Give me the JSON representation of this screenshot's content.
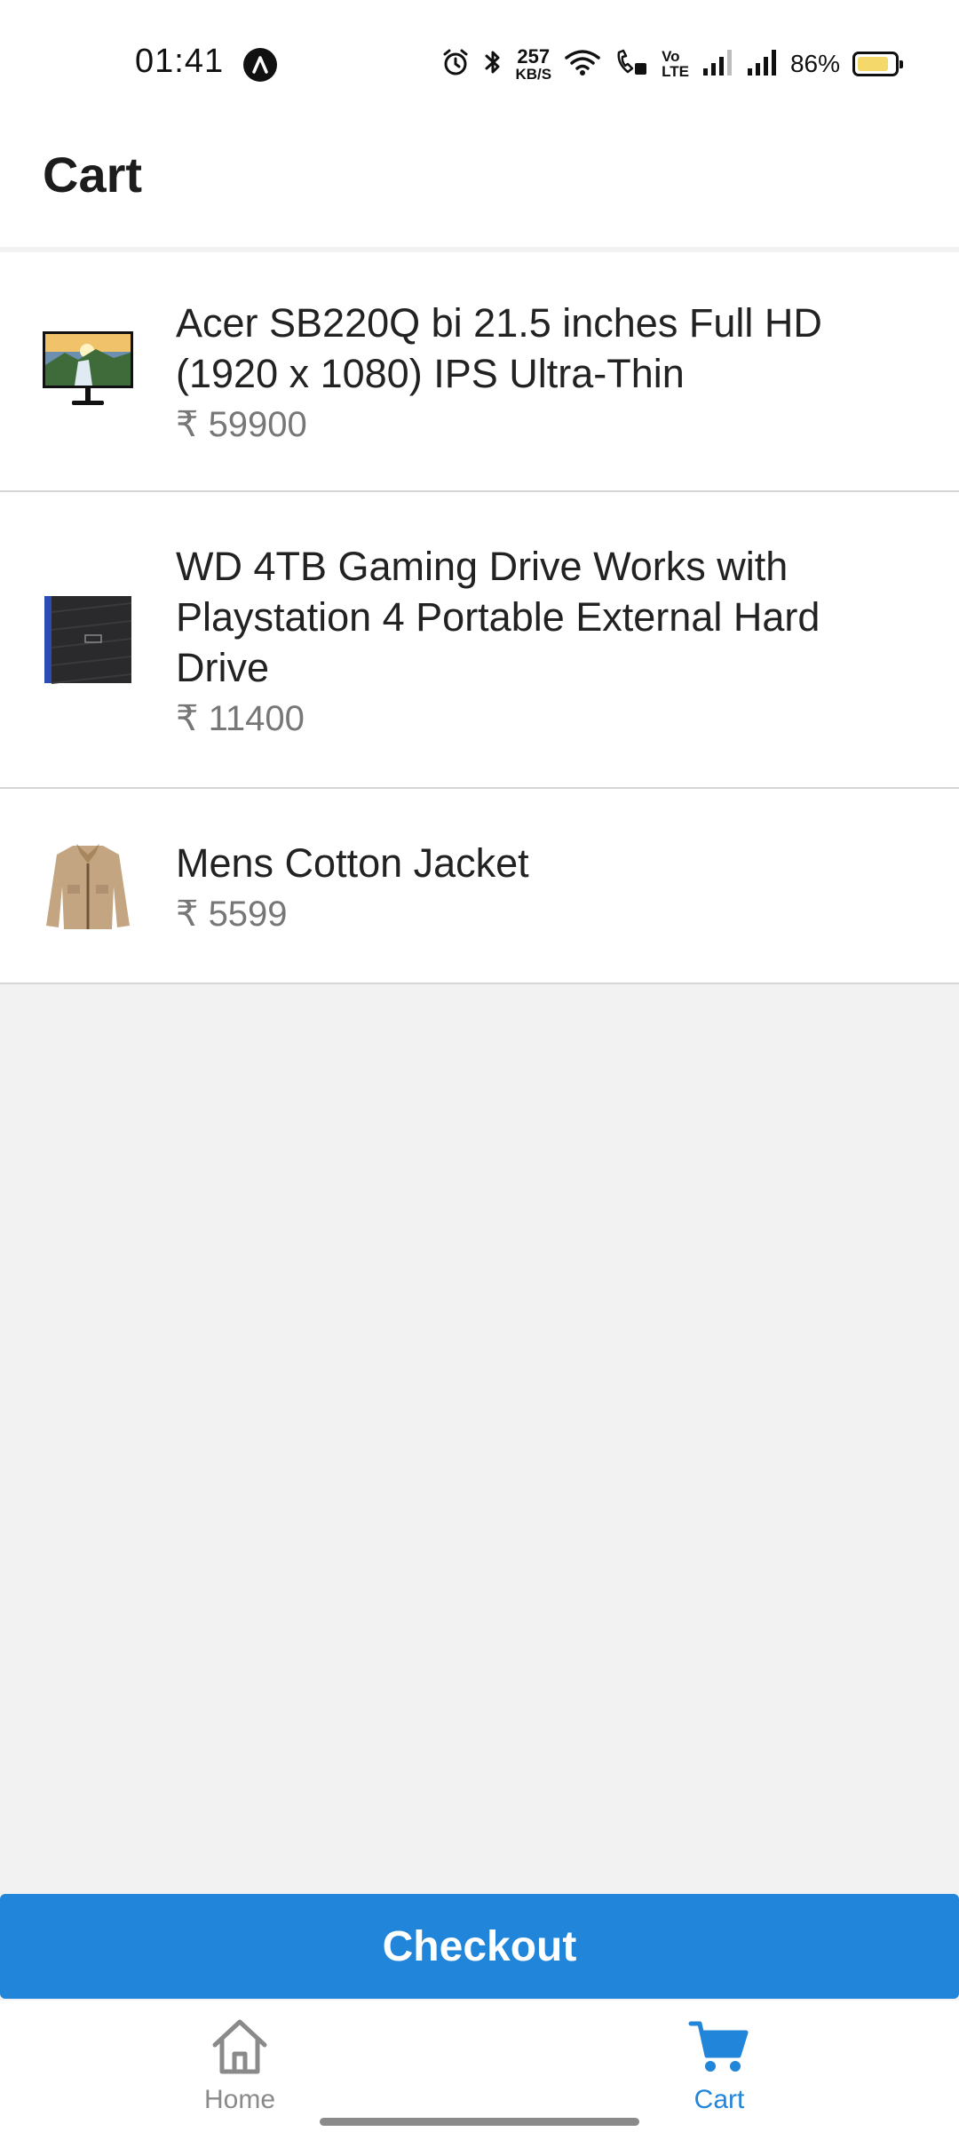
{
  "status_bar": {
    "time": "01:41",
    "net_speed_value": "257",
    "net_speed_unit": "KB/S",
    "volte_label_top": "Vo",
    "volte_label_bottom": "LTE",
    "battery_percent": "86%",
    "battery_level": 0.86,
    "icons": [
      "app-notification-icon",
      "alarm-icon",
      "bluetooth-icon",
      "wifi-icon",
      "wifi-calling-icon",
      "volte-icon",
      "signal-icon",
      "signal-icon",
      "battery-icon"
    ]
  },
  "header": {
    "title": "Cart"
  },
  "cart": {
    "currency_symbol": "₹",
    "items": [
      {
        "name": "Acer SB220Q bi 21.5 inches Full HD (1920 x 1080) IPS Ultra-Thin",
        "price": "₹ 59900",
        "thumbnail": "monitor-image"
      },
      {
        "name": "WD 4TB Gaming Drive Works with Playstation 4 Portable External Hard Drive",
        "price": "₹ 11400",
        "thumbnail": "hard-drive-image"
      },
      {
        "name": "Mens Cotton Jacket",
        "price": "₹ 5599",
        "thumbnail": "jacket-image"
      }
    ]
  },
  "checkout": {
    "label": "Checkout"
  },
  "bottom_nav": {
    "home_label": "Home",
    "cart_label": "Cart",
    "active": "Cart"
  },
  "colors": {
    "accent": "#2185d9",
    "inactive": "#8a8a8a",
    "background": "#f2f2f2"
  }
}
